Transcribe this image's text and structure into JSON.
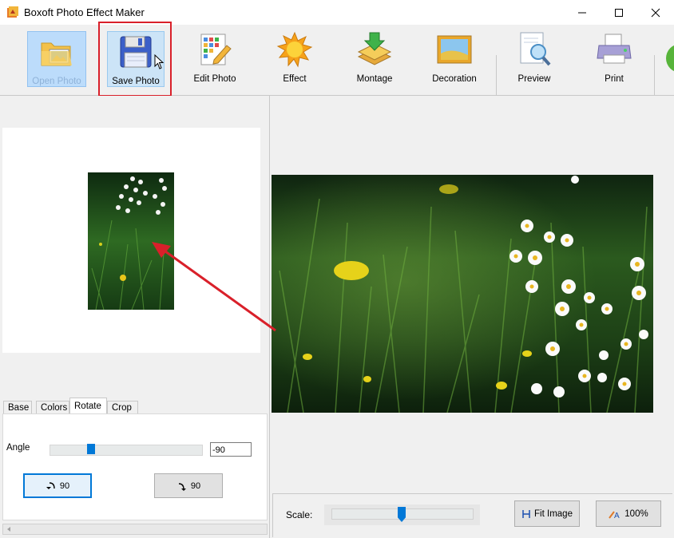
{
  "window": {
    "title": "Boxoft Photo Effect Maker",
    "minimize_icon": "minimize-icon",
    "maximize_icon": "maximize-icon",
    "close_icon": "close-icon"
  },
  "toolbar": {
    "items": [
      {
        "label": "Open Photo",
        "icon": "folder-photo-icon",
        "state": "disabled"
      },
      {
        "label": "Save Photo",
        "icon": "floppy-disk-icon",
        "state": "hover"
      },
      {
        "label": "Edit Photo",
        "icon": "grid-pencil-icon"
      },
      {
        "label": "Effect",
        "icon": "sun-icon"
      },
      {
        "label": "Montage",
        "icon": "layers-arrow-icon"
      },
      {
        "label": "Decoration",
        "icon": "picture-frame-icon"
      },
      {
        "label": "Preview",
        "icon": "magnifier-document-icon"
      },
      {
        "label": "Print",
        "icon": "printer-icon"
      }
    ]
  },
  "tabs": {
    "items": [
      "Base",
      "Colors",
      "Rotate",
      "Crop"
    ],
    "active": "Rotate"
  },
  "rotate": {
    "angle_label": "Angle",
    "angle_value": "-90",
    "rotate_left_label": "90",
    "rotate_right_label": "90"
  },
  "bottom": {
    "scale_label": "Scale:",
    "fit_label": "Fit Image",
    "zoom_label": "100%"
  },
  "colors": {
    "accent": "#0078d7",
    "highlight_box": "#d9202a",
    "annotation_arrow": "#d9202a"
  }
}
